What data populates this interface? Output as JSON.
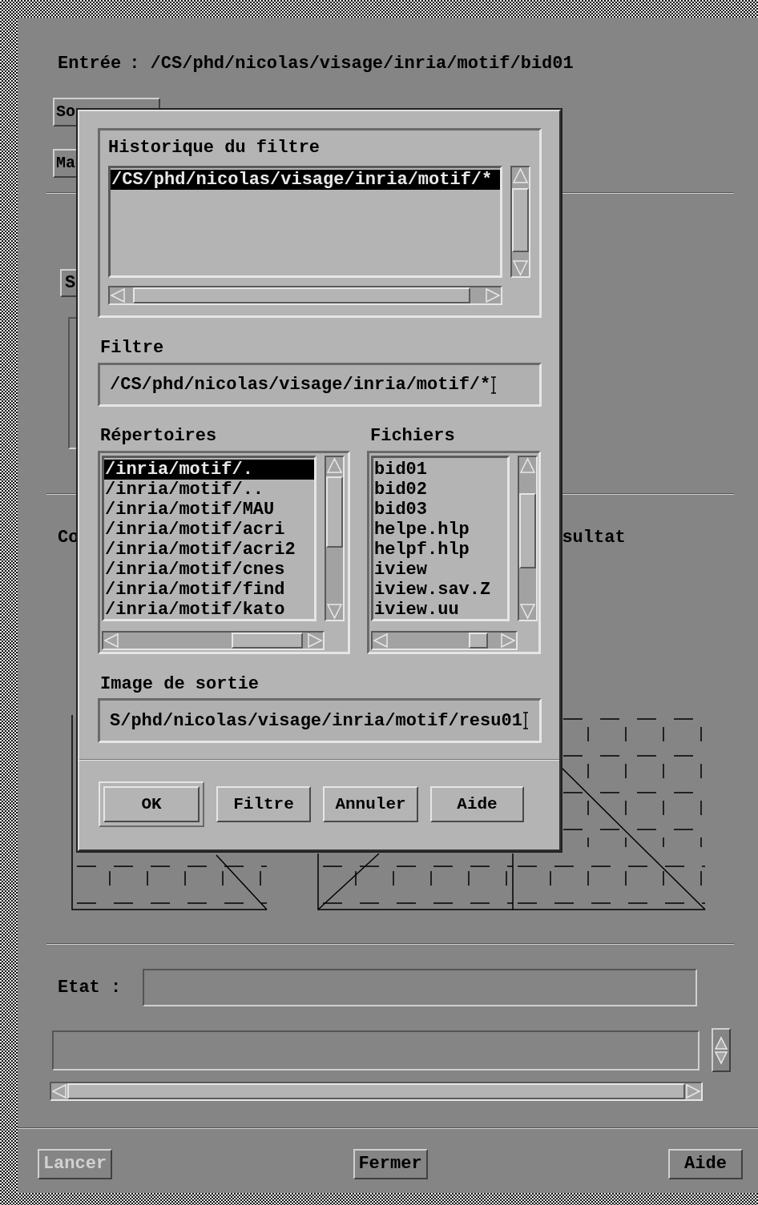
{
  "main_window": {
    "input": {
      "label": "Entrée",
      "value": ": /CS/phd/nicolas/visage/inria/motif/bid01"
    },
    "top_buttons": [
      {
        "label": "So"
      },
      {
        "label": "Ma"
      }
    ],
    "middle_button": {
      "label": "S"
    },
    "section_labels": [
      {
        "text": "Co"
      },
      {
        "text": "sultat"
      }
    ],
    "state": {
      "label": "Etat :"
    },
    "footer_buttons": [
      {
        "label": "Lancer",
        "disabled": true
      },
      {
        "label": "Fermer",
        "disabled": false
      },
      {
        "label": "Aide",
        "disabled": false
      }
    ]
  },
  "dialog": {
    "history": {
      "label": "Historique du filtre",
      "items": [
        {
          "text": "/CS/phd/nicolas/visage/inria/motif/*",
          "selected": true
        }
      ]
    },
    "filter": {
      "label": "Filtre",
      "value": "/CS/phd/nicolas/visage/inria/motif/*"
    },
    "directories": {
      "label": "Répertoires",
      "items": [
        {
          "text": "/inria/motif/.",
          "selected": true
        },
        {
          "text": "/inria/motif/..",
          "selected": false
        },
        {
          "text": "/inria/motif/MAU",
          "selected": false
        },
        {
          "text": "/inria/motif/acri",
          "selected": false
        },
        {
          "text": "/inria/motif/acri2",
          "selected": false
        },
        {
          "text": "/inria/motif/cnes",
          "selected": false
        },
        {
          "text": "/inria/motif/find",
          "selected": false
        },
        {
          "text": "/inria/motif/kato",
          "selected": false
        }
      ]
    },
    "files": {
      "label": "Fichiers",
      "items": [
        {
          "text": "bid01",
          "selected": false
        },
        {
          "text": "bid02",
          "selected": false
        },
        {
          "text": "bid03",
          "selected": false
        },
        {
          "text": "helpe.hlp",
          "selected": false
        },
        {
          "text": "helpf.hlp",
          "selected": false
        },
        {
          "text": "iview",
          "selected": false
        },
        {
          "text": "iview.sav.Z",
          "selected": false
        },
        {
          "text": "iview.uu",
          "selected": false
        }
      ]
    },
    "output": {
      "label": "Image de sortie",
      "value": "S/phd/nicolas/visage/inria/motif/resu01"
    },
    "buttons": [
      {
        "label": "OK",
        "default": true
      },
      {
        "label": "Filtre",
        "default": false
      },
      {
        "label": "Annuler",
        "default": false
      },
      {
        "label": "Aide",
        "default": false
      }
    ]
  }
}
